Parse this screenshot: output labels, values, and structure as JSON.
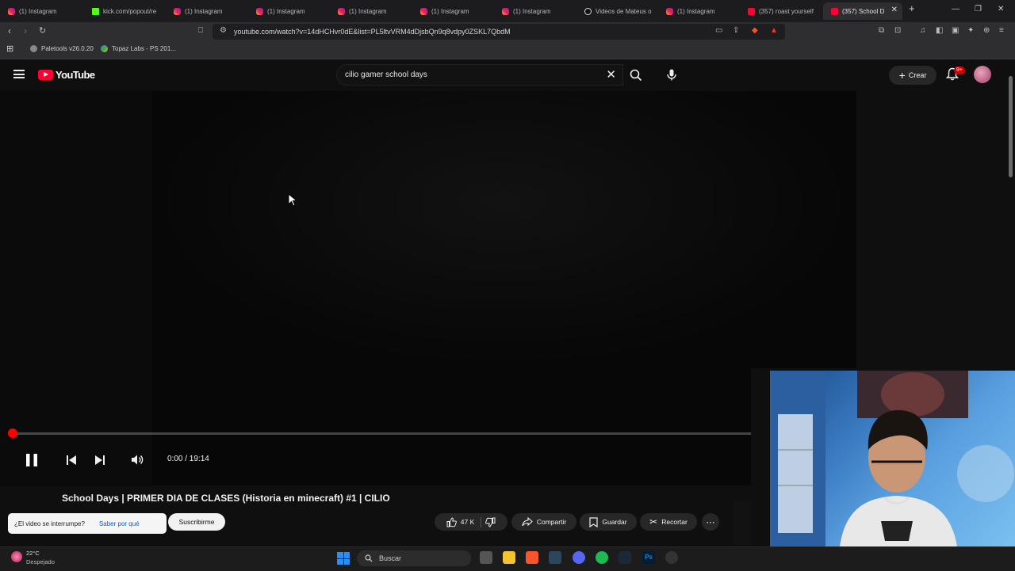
{
  "browser": {
    "tabs": [
      {
        "label": "(1) Instagram",
        "favicon": "instagram-icon"
      },
      {
        "label": "kick.com/popout/re",
        "favicon": "kick-icon"
      },
      {
        "label": "(1) Instagram",
        "favicon": "instagram-icon"
      },
      {
        "label": "(1) Instagram",
        "favicon": "instagram-icon"
      },
      {
        "label": "(1) Instagram",
        "favicon": "instagram-icon"
      },
      {
        "label": "(1) Instagram",
        "favicon": "instagram-icon"
      },
      {
        "label": "(1) Instagram",
        "favicon": "instagram-icon"
      },
      {
        "label": "Videos de Mateus o",
        "favicon": "tiktok-icon"
      },
      {
        "label": "(1) Instagram",
        "favicon": "instagram-icon"
      },
      {
        "label": "(357) roast yourself",
        "favicon": "youtube-icon"
      },
      {
        "label": "(357) School D",
        "favicon": "youtube-icon",
        "active": true
      }
    ],
    "new_tab": "+",
    "url": "youtube.com/watch?v=14dHCHvr0dE&list=PL5ltvVRM4dDjsbQn9q8vdpy0ZSKL7QbdM",
    "bookmarks": [
      {
        "label": "Paletools v26.0.20"
      },
      {
        "label": "Topaz Labs - PS 201..."
      }
    ]
  },
  "youtube": {
    "logo_text": "YouTube",
    "search_query": "cilio gamer school days",
    "create_label": "Crear",
    "notifications_badge": "9+"
  },
  "player": {
    "current_time": "0:00",
    "duration": "19:14",
    "time_display": "0:00 / 19:14",
    "progress": 0.0
  },
  "video": {
    "title": "School Days | PRIMER DIA DE CLASES (Historia en minecraft) #1 | CILIO",
    "interrupt_question": "¿El video se interrumpe?",
    "interrupt_link": "Saber por qué",
    "subscribe_label": "Suscribirme",
    "likes": "47 K",
    "share_label": "Compartir",
    "save_label": "Guardar",
    "clip_label": "Recortar"
  },
  "taskbar": {
    "temperature": "22°C",
    "weather": "Despejado",
    "search_label": "Buscar"
  },
  "colors": {
    "youtube_red": "#ff0033",
    "background": "#0f0f0f",
    "webcam_light": "#5aa0e0"
  }
}
